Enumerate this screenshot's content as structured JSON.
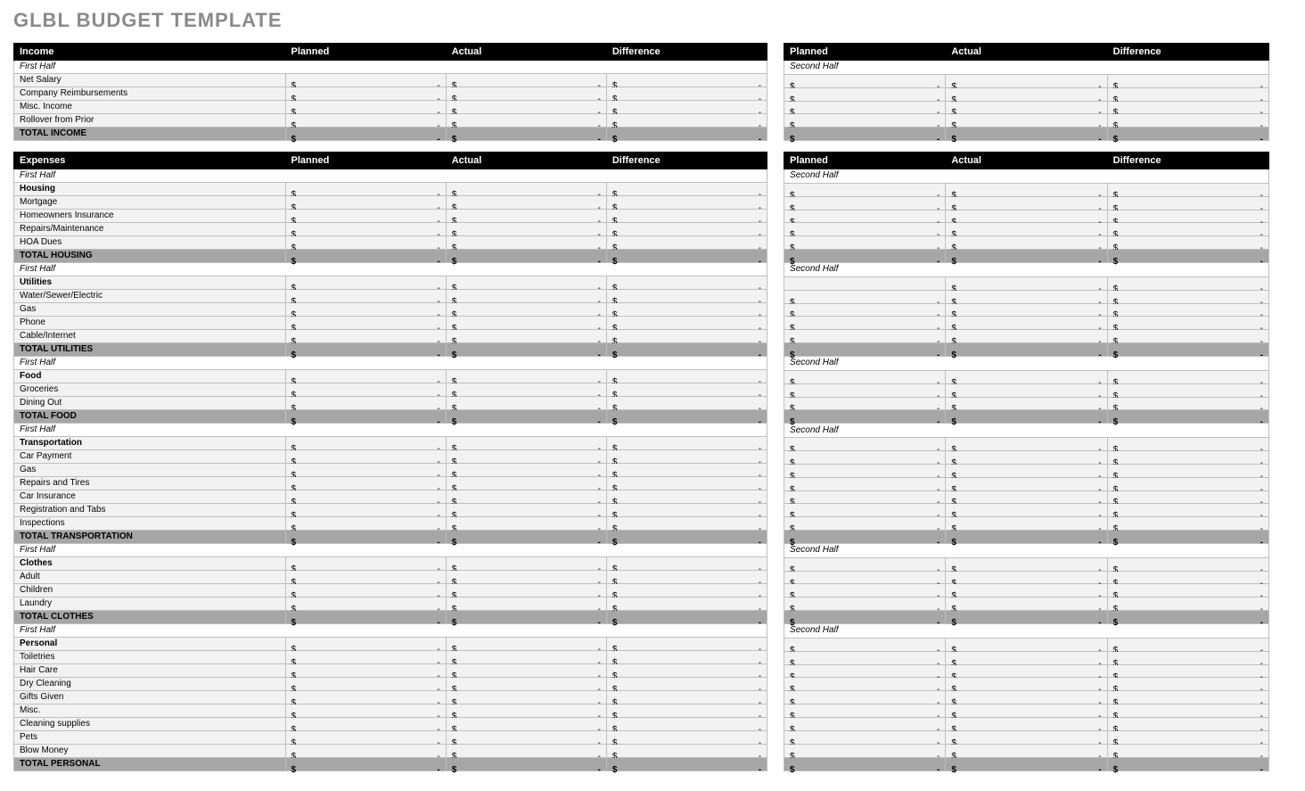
{
  "title": "GLBL BUDGET TEMPLATE",
  "headers": {
    "income": "Income",
    "expenses": "Expenses",
    "planned": "Planned",
    "actual": "Actual",
    "difference": "Difference"
  },
  "labels": {
    "first_half": "First Half",
    "second_half": "Second Half"
  },
  "money": {
    "currency": "$",
    "dash": "-"
  },
  "income": {
    "rows": [
      "Net Salary",
      "Company Reimbursements",
      "Misc. Income",
      "Rollover from Prior"
    ],
    "total": "TOTAL INCOME"
  },
  "expenses": [
    {
      "cat": "Housing",
      "rows": [
        "Mortgage",
        "Homeowners Insurance",
        "Repairs/Maintenance",
        "HOA Dues"
      ],
      "total": "TOTAL HOUSING"
    },
    {
      "cat": "Utilities",
      "rows": [
        "Water/Sewer/Electric",
        "Gas",
        "Phone",
        "Cable/Internet"
      ],
      "total": "TOTAL UTILITIES"
    },
    {
      "cat": "Food",
      "rows": [
        "Groceries",
        "Dining Out"
      ],
      "total": "TOTAL FOOD"
    },
    {
      "cat": "Transportation",
      "rows": [
        "Car Payment",
        "Gas",
        "Repairs and Tires",
        "Car Insurance",
        "Registration and Tabs",
        "Inspections"
      ],
      "total": "TOTAL TRANSPORTATION"
    },
    {
      "cat": "Clothes",
      "rows": [
        "Adult",
        "Children",
        "Laundry"
      ],
      "total": "TOTAL CLOTHES"
    },
    {
      "cat": "Personal",
      "rows": [
        "Toiletries",
        "Hair Care",
        "Dry Cleaning",
        "Gifts Given",
        "Misc.",
        "Cleaning supplies",
        "Pets",
        "Blow Money"
      ],
      "total": "TOTAL PERSONAL"
    }
  ]
}
